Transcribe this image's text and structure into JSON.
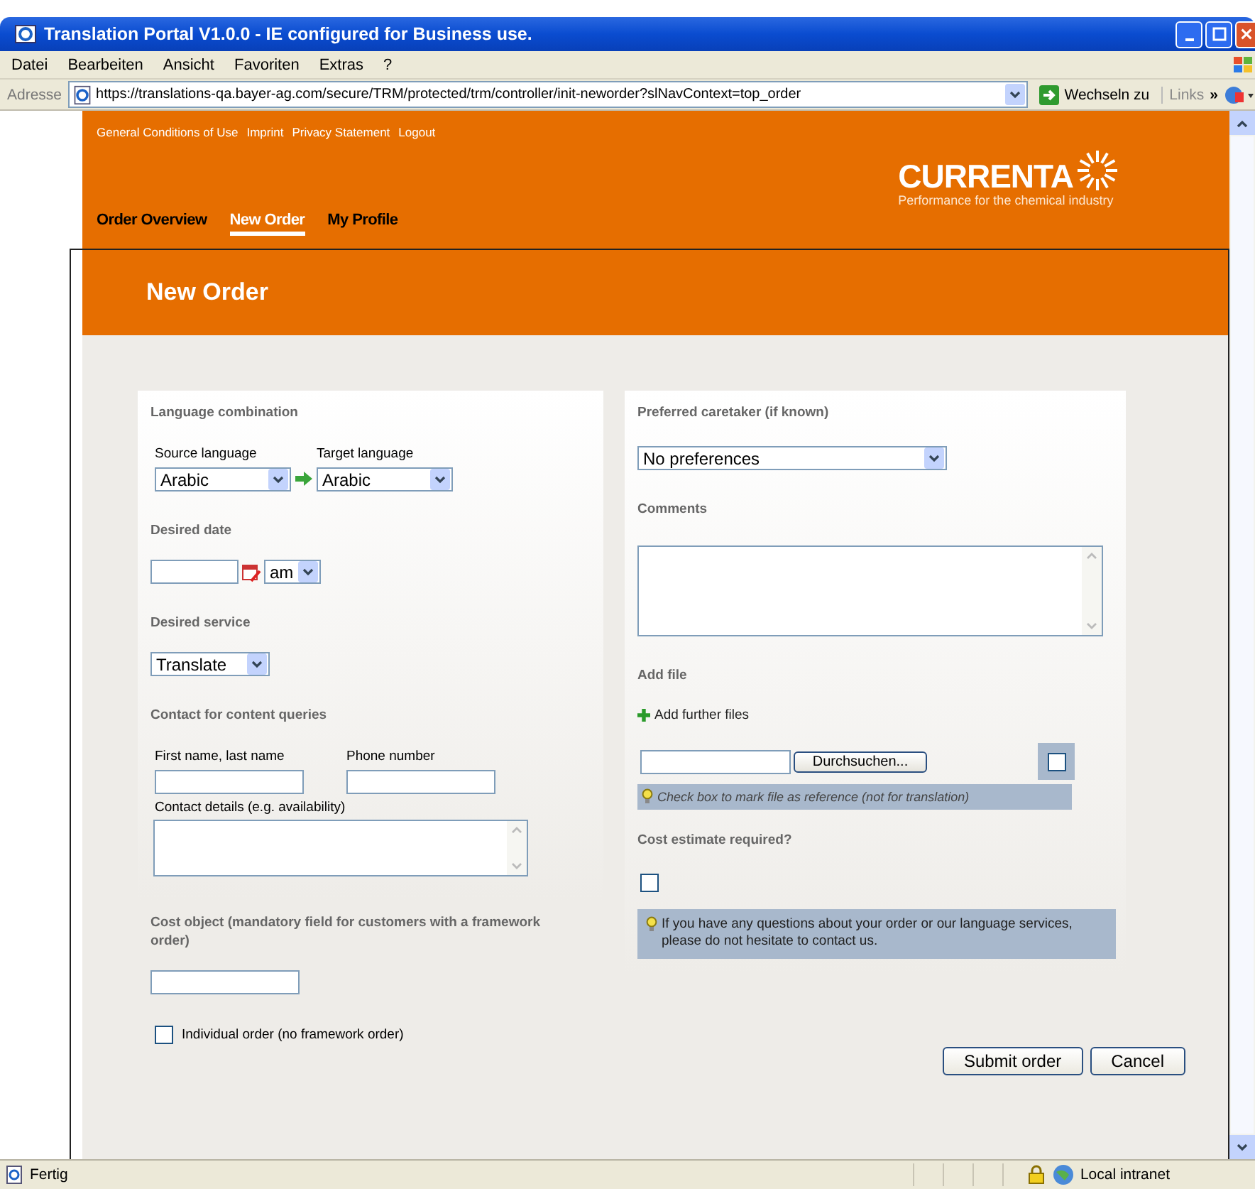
{
  "window": {
    "title": "Translation Portal V1.0.0 - IE configured for Business use."
  },
  "menu": [
    "Datei",
    "Bearbeiten",
    "Ansicht",
    "Favoriten",
    "Extras",
    "?"
  ],
  "address_bar": {
    "label": "Adresse",
    "url": "https://translations-qa.bayer-ag.com/secure/TRM/protected/trm/controller/init-neworder?slNavContext=top_order",
    "go": "Wechseln zu",
    "links": "Links",
    "more": "»"
  },
  "header": {
    "top_links": [
      "General Conditions of Use",
      "Imprint",
      "Privacy Statement",
      "Logout"
    ],
    "logo": "CURRENTA",
    "tagline": "Performance for the chemical industry",
    "tabs": [
      {
        "label": "Order Overview",
        "selected": false
      },
      {
        "label": "New Order",
        "selected": true
      },
      {
        "label": "My Profile",
        "selected": false
      }
    ],
    "page_title": "New Order"
  },
  "left": {
    "language_heading": "Language combination",
    "source_label": "Source language",
    "source_value": "Arabic",
    "target_label": "Target language",
    "target_value": "Arabic",
    "date_heading": "Desired date",
    "ampm": "am",
    "service_heading": "Desired service",
    "service": "Translate",
    "contact_heading": "Contact for content queries",
    "name_label": "First name, last name",
    "phone_label": "Phone number",
    "details_label": "Contact details (e.g. availability)",
    "cost_object_heading": "Cost object (mandatory field for customers with a framework order)",
    "individual_order": {
      "label": "Individual order (no framework order)",
      "checked": false
    }
  },
  "right": {
    "caretaker_heading": "Preferred caretaker (if known)",
    "caretaker": "No preferences",
    "comments_heading": "Comments",
    "file_heading": "Add file",
    "add_files": "Add further files",
    "browse": "Durchsuchen...",
    "reference": {
      "checked": false,
      "hint": "Check box to mark file as reference (not for translation)"
    },
    "estimate_heading": "Cost estimate required?",
    "estimate": {
      "checked": false
    },
    "info": "If you have any questions about your order or our language services, please do not hesitate to contact us."
  },
  "buttons": [
    "Submit order",
    "Cancel"
  ],
  "status_bar": {
    "status": "Fertig",
    "zone": "Local intranet"
  }
}
